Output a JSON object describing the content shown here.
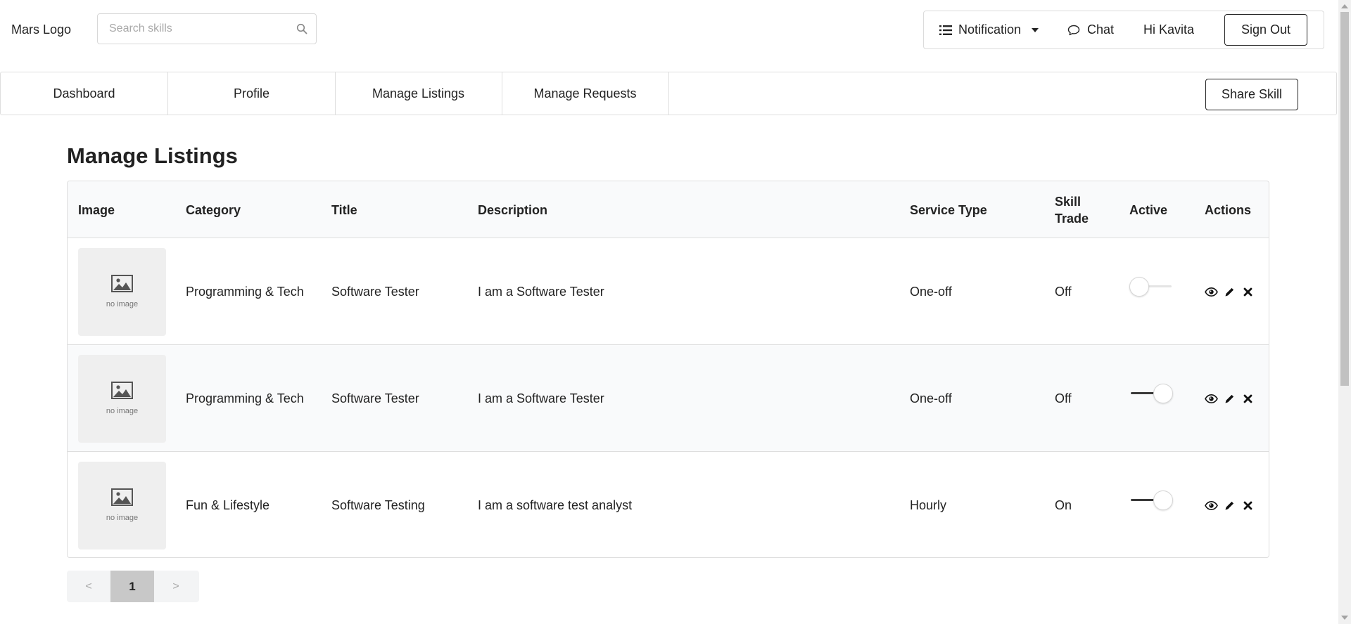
{
  "header": {
    "logo": "Mars Logo",
    "search": {
      "placeholder": "Search skills",
      "value": "",
      "icon": "search-icon"
    },
    "user_menu": {
      "notification_label": "Notification",
      "notification_icon": "list-icon",
      "chat_label": "Chat",
      "chat_icon": "chat-bubble-icon",
      "greeting": "Hi Kavita",
      "sign_out_label": "Sign Out"
    }
  },
  "nav": {
    "tabs": [
      {
        "label": "Dashboard"
      },
      {
        "label": "Profile"
      },
      {
        "label": "Manage Listings"
      },
      {
        "label": "Manage Requests"
      }
    ],
    "share_skill_label": "Share Skill"
  },
  "main": {
    "title": "Manage Listings",
    "table": {
      "headers": [
        "Image",
        "Category",
        "Title",
        "Description",
        "Service Type",
        "Skill Trade",
        "Active",
        "Actions"
      ],
      "rows": [
        {
          "image_text": "no image",
          "category": "Programming & Tech",
          "title": "Software Tester",
          "description": "I am a Software Tester",
          "service_type": "One-off",
          "skill_trade": "Off",
          "active": false
        },
        {
          "image_text": "no image",
          "category": "Programming & Tech",
          "title": "Software Tester",
          "description": "I am a Software Tester",
          "service_type": "One-off",
          "skill_trade": "Off",
          "active": true
        },
        {
          "image_text": "no image",
          "category": "Fun & Lifestyle",
          "title": "Software Testing",
          "description": "I am a software test analyst",
          "service_type": "Hourly",
          "skill_trade": "On",
          "active": true
        }
      ],
      "action_icons": [
        "eye-icon",
        "pencil-icon",
        "close-icon"
      ]
    },
    "pagination": {
      "prev": "<",
      "current": "1",
      "next": ">"
    }
  },
  "colors": {
    "text": "#222222",
    "border": "#dedede",
    "header_bg": "#f9fafb",
    "pager_current_bg": "#c8c8c8",
    "toggle_on_track": "#3a3a3a"
  }
}
